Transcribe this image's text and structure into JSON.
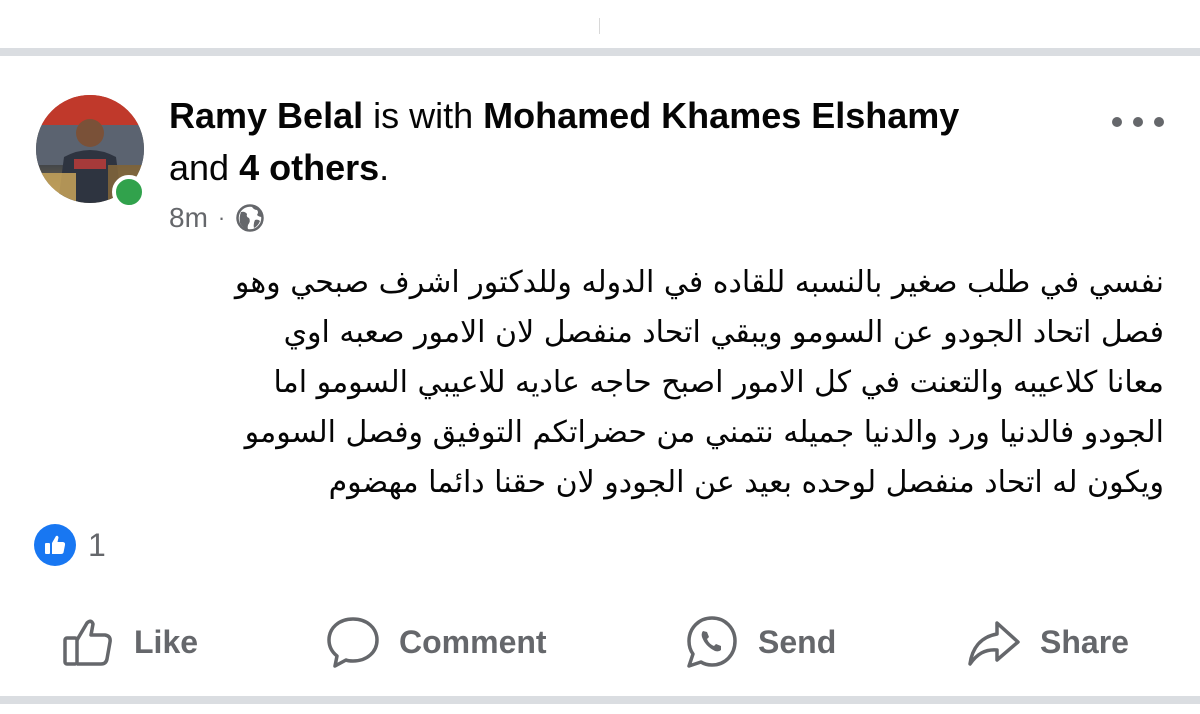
{
  "post": {
    "author": "Ramy Belal",
    "with_word": "is with",
    "tagged": "Mohamed Khames Elshamy",
    "and_word": "and",
    "others": "4 others",
    "period": ".",
    "time": "8m",
    "separator": "·",
    "audience_icon": "globe-icon",
    "body_lines": [
      "نفسي في طلب صغير بالنسبه للقاده في الدوله وللدكتور اشرف صبحي  وهو",
      "فصل اتحاد الجودو عن السومو ويبقي اتحاد منفصل لان الامور صعبه اوي",
      "معانا كلاعيبه والتعنت في كل الامور اصبح حاجه عاديه للاعيبي السومو اما",
      "الجودو فالدنيا ورد والدنيا جميله نتمني من حضراتكم التوفيق وفصل السومو",
      "ويكون له اتحاد منفصل لوحده بعيد عن الجودو لان حقنا دائما مهضوم"
    ]
  },
  "reactions": {
    "icon": "like-icon",
    "count": "1"
  },
  "actions": {
    "like": "Like",
    "comment": "Comment",
    "send": "Send",
    "share": "Share"
  },
  "colors": {
    "accent": "#1877f2",
    "online": "#31a24c",
    "secondary_text": "#65676b",
    "divider": "#dadde1"
  }
}
